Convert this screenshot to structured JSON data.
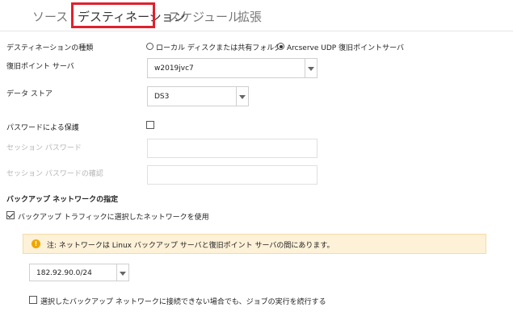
{
  "tabs": [
    {
      "label": "ソース"
    },
    {
      "label": "デスティネーション"
    },
    {
      "label": "スケジュール"
    },
    {
      "label": "拡張"
    }
  ],
  "destination_type": {
    "label": "デスティネーションの種類",
    "option_local": "ローカル ディスクまたは共有フォルダ",
    "option_rps": "Arcserve UDP 復旧ポイントサーバ",
    "selected": "option_rps"
  },
  "recovery_point_server": {
    "label": "復旧ポイント サーバ",
    "value": "w2019jvc7"
  },
  "data_store": {
    "label": "データ ストア",
    "value": "DS3"
  },
  "password_protection": {
    "label": "パスワードによる保護",
    "checked": false
  },
  "session_password": {
    "label": "セッション パスワード"
  },
  "session_password_confirm": {
    "label": "セッション パスワードの確認"
  },
  "backup_network": {
    "heading": "バックアップ ネットワークの指定",
    "use_selected_label": "バックアップ トラフィックに選択したネットワークを使用",
    "use_selected_checked": true,
    "note": "注: ネットワークは Linux バックアップ サーバと復旧ポイント サーバの間にあります。",
    "network_value": "182.92.90.0/24",
    "continue_label": "選択したバックアップ ネットワークに接続できない場合でも、ジョブの実行を続行する",
    "continue_checked": false
  },
  "colors": {
    "highlight_border": "#e0202e",
    "warning_bg": "#fdf1d8",
    "warning_icon": "#f0a500"
  }
}
